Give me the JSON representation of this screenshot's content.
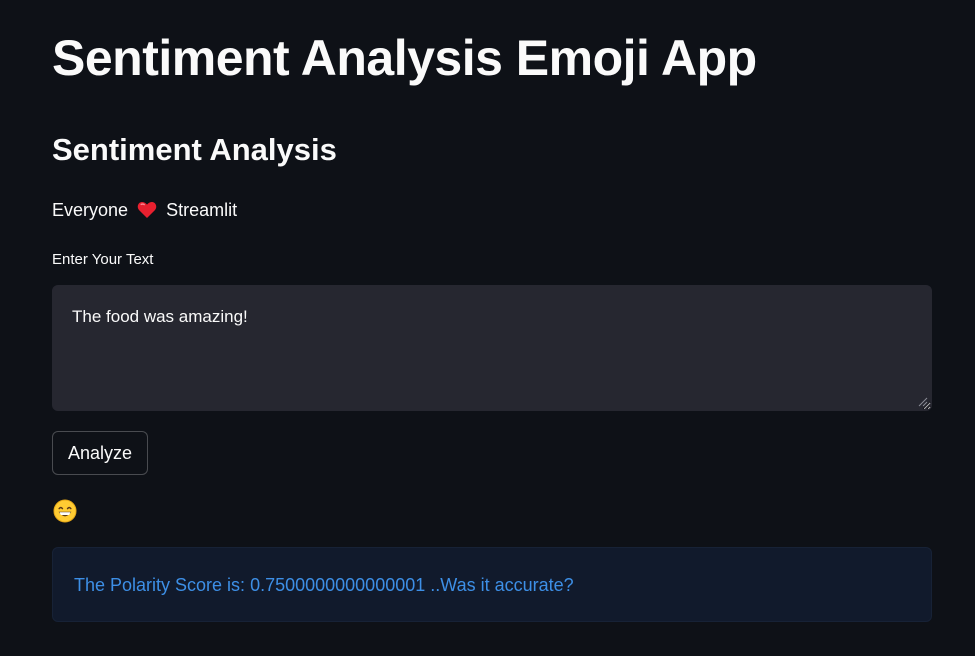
{
  "app": {
    "title": "Sentiment Analysis Emoji App",
    "subtitle": "Sentiment Analysis",
    "tagline_before": "Everyone",
    "tagline_after": "Streamlit",
    "tagline_icon": "red-heart-icon"
  },
  "form": {
    "label": "Enter Your Text",
    "text_value": "The food was amazing!",
    "button_label": "Analyze"
  },
  "result": {
    "emoji": "grinning-face-icon",
    "message": "The Polarity Score is: 0.7500000000000001 ..Was it accurate?"
  },
  "colors": {
    "background": "#0e1117",
    "input_background": "#262730",
    "info_background": "#111a2c",
    "info_text": "#3d8fe6",
    "heart": "#e8202f"
  }
}
